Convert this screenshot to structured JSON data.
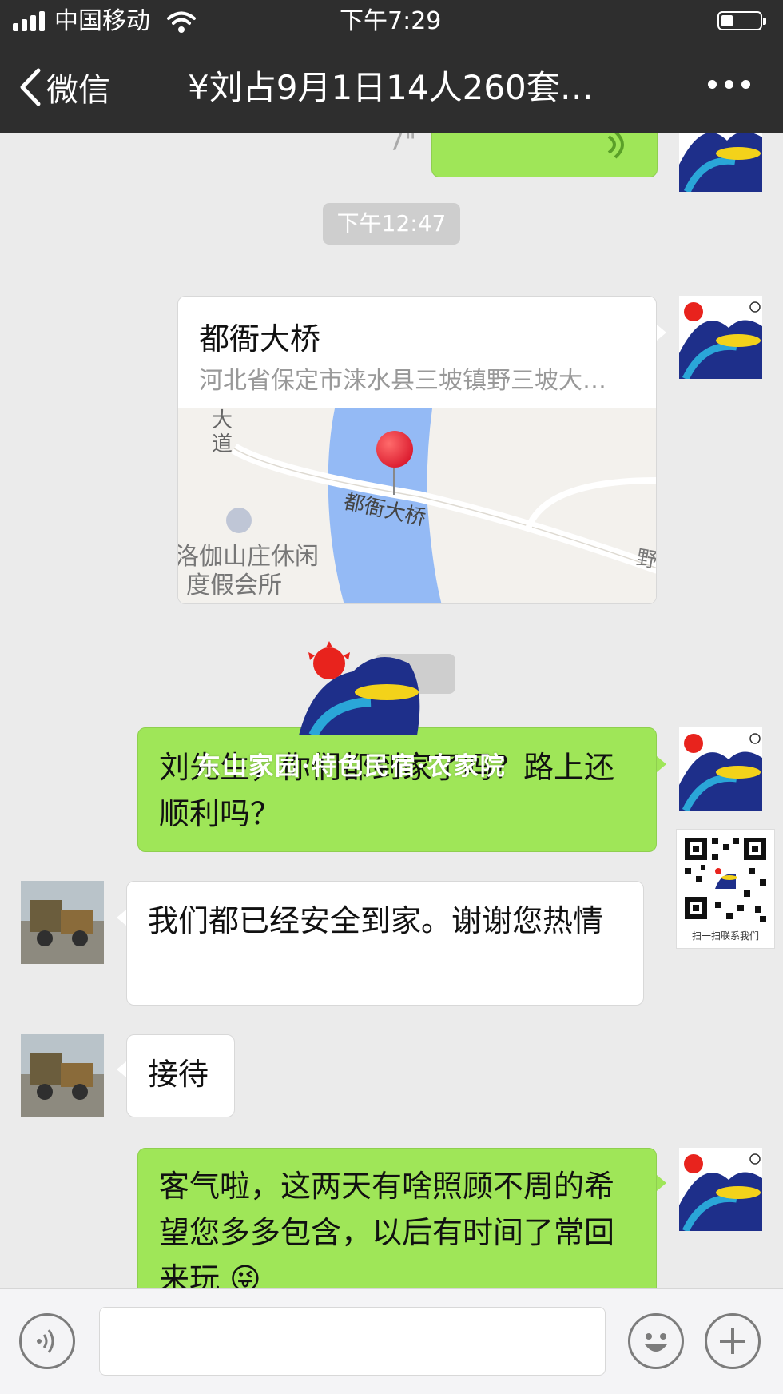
{
  "status_bar": {
    "carrier": "中国移动",
    "time": "下午7:29"
  },
  "nav": {
    "back_label": "微信",
    "title": "¥刘占9月1日14人260套…"
  },
  "chat": {
    "time_divider": "下午12:47",
    "location": {
      "title": "都衙大桥",
      "address": "河北省保定市涞水县三坡镇野三坡大…",
      "map_labels": {
        "road_partial": "大道",
        "bridge": "都衙大桥",
        "resort_line1": "洛伽山庄休闲",
        "resort_line2": "度假会所",
        "edge": "野"
      }
    },
    "messages": [
      {
        "side": "right",
        "text": "刘先生，你们都到家了吗？路上还顺利吗？"
      },
      {
        "side": "left",
        "text": "我们都已经安全到家。谢谢您热情"
      },
      {
        "side": "left",
        "text": "接待"
      },
      {
        "side": "right",
        "text": "客气啦，这两天有啥照顾不周的希望您多多包含，以后有时间了常回来玩"
      }
    ],
    "emoji": "😜"
  },
  "watermark": {
    "text": "东山家园·特色民宿·农家院",
    "qr_caption": "扫一扫联系我们"
  },
  "colors": {
    "nav_bg": "#2e2e2e",
    "chat_bg": "#ebebeb",
    "green_bubble": "#9fe658",
    "time_pill": "#cecece"
  }
}
